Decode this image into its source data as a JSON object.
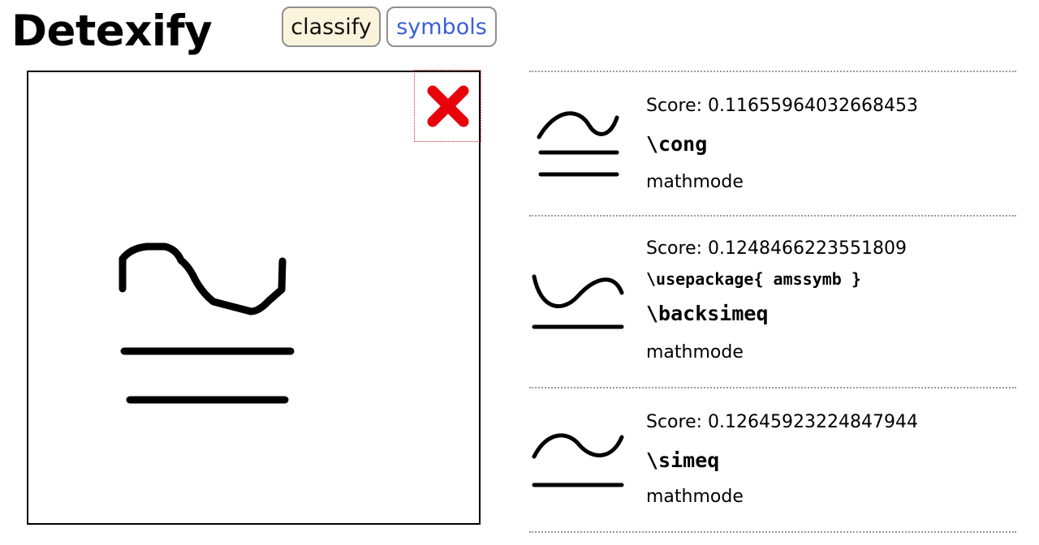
{
  "header": {
    "logo": "Detexify",
    "nav": {
      "classify_label": "classify",
      "symbols_label": "symbols"
    }
  },
  "canvas": {
    "clear_icon": "close-icon",
    "clear_color": "#e8000b"
  },
  "results": [
    {
      "glyph": "cong-symbol",
      "score": "Score: 0.11655964032668453",
      "package": "",
      "command": "\\cong",
      "mode": "mathmode"
    },
    {
      "glyph": "backsimeq-symbol",
      "score": "Score: 0.1248466223551809",
      "package": "\\usepackage{ amssymb }",
      "command": "\\backsimeq",
      "mode": "mathmode"
    },
    {
      "glyph": "simeq-symbol",
      "score": "Score: 0.12645923224847944",
      "package": "",
      "command": "\\simeq",
      "mode": "mathmode"
    }
  ]
}
